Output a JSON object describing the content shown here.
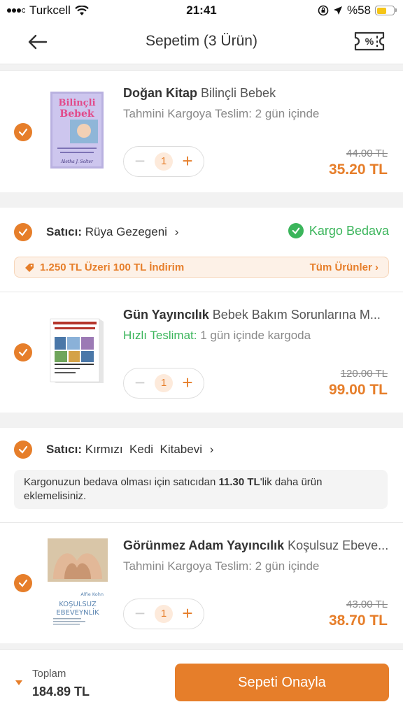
{
  "status": {
    "carrier": "Turkcell",
    "time": "21:41",
    "battery": "%58",
    "battery_level": 0.58
  },
  "header": {
    "title": "Sepetim (3 Ürün)",
    "back_icon": "arrow-left-icon",
    "coupon_icon": "coupon-percent-icon"
  },
  "items": [
    {
      "brand": "Doğan Kitap",
      "name": "Bilinçli Bebek",
      "delivery_label": "Tahmini Kargoya Teslim:",
      "delivery_value": "2 gün içinde",
      "qty": "1",
      "old_price": "44.00 TL",
      "price": "35.20 TL",
      "cover_title_1": "Bilinçli",
      "cover_title_2": "Bebek",
      "cover_author": "Aletha J. Solter"
    },
    {
      "brand": "Gün Yayıncılık",
      "name": "Bebek Bakım Sorunlarına M...",
      "delivery_label": "Hızlı Teslimat:",
      "delivery_value": "1 gün içinde kargoda",
      "qty": "1",
      "old_price": "120.00 TL",
      "price": "99.00 TL"
    },
    {
      "brand": "Görünmez Adam Yayıncılık",
      "name": "Koşulsuz Ebeve...",
      "delivery_label": "Tahmini Kargoya Teslim:",
      "delivery_value": "2 gün içinde",
      "qty": "1",
      "old_price": "43.00 TL",
      "price": "38.70 TL",
      "cover_author": "Alfie Kohn",
      "cover_title_1": "KOŞULSUZ",
      "cover_title_2": "EBEVEYNLİK"
    }
  ],
  "sellers": [
    {
      "label": "Satıcı:",
      "name": "Rüya Gezegeni",
      "free_shipping": "Kargo Bedava",
      "promo_text": "1.250 TL Üzeri 100 TL İndirim",
      "promo_link": "Tüm Ürünler"
    },
    {
      "label": "Satıcı:",
      "name": "Kırmızı  Kedi  Kitabevi",
      "notice_pre": "Kargonuzun bedava olması için satıcıdan ",
      "notice_bold": "11.30 TL",
      "notice_post": "'lik daha ürün eklemelisiniz."
    }
  ],
  "footer": {
    "total_label": "Toplam",
    "total_value": "184.89 TL",
    "confirm_label": "Sepeti Onayla"
  },
  "colors": {
    "accent": "#e67e2a",
    "green": "#3bb55b"
  }
}
